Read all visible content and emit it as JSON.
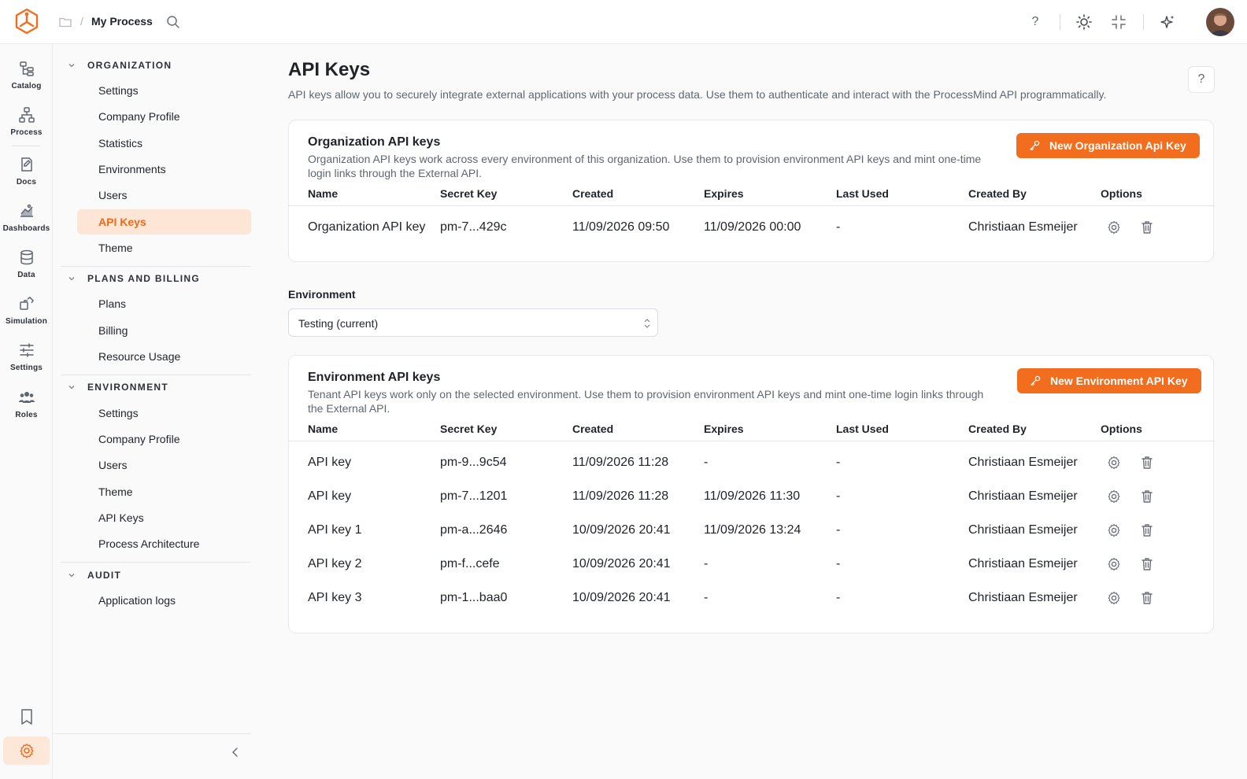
{
  "topbar": {
    "breadcrumb_sep": "/",
    "process_name": "My Process",
    "help_glyph": "?",
    "icons": [
      "logo-icon",
      "folder-icon",
      "search-icon",
      "help-icon",
      "sun-icon",
      "collapse-icon",
      "sparkle-icon",
      "avatar"
    ]
  },
  "rail": {
    "items": [
      {
        "label": "Catalog",
        "icon": "catalog-icon"
      },
      {
        "label": "Process",
        "icon": "process-icon"
      },
      {
        "label": "Docs",
        "icon": "docs-icon"
      },
      {
        "label": "Dashboards",
        "icon": "dashboards-icon"
      },
      {
        "label": "Data",
        "icon": "database-icon"
      },
      {
        "label": "Simulation",
        "icon": "simulation-icon"
      },
      {
        "label": "Settings",
        "icon": "sliders-icon"
      },
      {
        "label": "Roles",
        "icon": "users-icon"
      }
    ]
  },
  "sidenav": {
    "sections": [
      {
        "title": "ORGANIZATION",
        "items": [
          "Settings",
          "Company Profile",
          "Statistics",
          "Environments",
          "Users",
          "API Keys",
          "Theme"
        ]
      },
      {
        "title": "PLANS AND BILLING",
        "items": [
          "Plans",
          "Billing",
          "Resource Usage"
        ]
      },
      {
        "title": "ENVIRONMENT",
        "items": [
          "Settings",
          "Company Profile",
          "Users",
          "Theme",
          "API Keys",
          "Process Architecture"
        ]
      },
      {
        "title": "AUDIT",
        "items": [
          "Application logs"
        ]
      }
    ],
    "active_item": "API Keys"
  },
  "page": {
    "title": "API Keys",
    "description": "API keys allow you to securely integrate external applications with your process data. Use them to authenticate and interact with the ProcessMind API programmatically.",
    "help_label": "?"
  },
  "org_card": {
    "title": "Organization API keys",
    "description": "Organization API keys work across every environment of this organization. Use them to provision environment API keys and mint one-time login links through the External API.",
    "button_label": "New Organization Api Key",
    "columns": [
      "Name",
      "Secret Key",
      "Created",
      "Expires",
      "Last Used",
      "Created By",
      "Options"
    ],
    "rows": [
      {
        "name": "Organization API key",
        "secret": "pm-7...429c",
        "created": "11/09/2026 09:50",
        "expires": "11/09/2026 00:00",
        "last_used": "-",
        "created_by": "Christiaan Esmeijer"
      }
    ]
  },
  "environment": {
    "label": "Environment",
    "selected": "Testing (current)"
  },
  "env_card": {
    "title": "Environment API keys",
    "description": "Tenant API keys work only on the selected environment. Use them to provision environment API keys and mint one-time login links through the External API.",
    "button_label": "New Environment API Key",
    "columns": [
      "Name",
      "Secret Key",
      "Created",
      "Expires",
      "Last Used",
      "Created By",
      "Options"
    ],
    "rows": [
      {
        "name": "API key",
        "secret": "pm-9...9c54",
        "created": "11/09/2026 11:28",
        "expires": "-",
        "last_used": "-",
        "created_by": "Christiaan Esmeijer"
      },
      {
        "name": "API key",
        "secret": "pm-7...1201",
        "created": "11/09/2026 11:28",
        "expires": "11/09/2026 11:30",
        "last_used": "-",
        "created_by": "Christiaan Esmeijer"
      },
      {
        "name": "API key 1",
        "secret": "pm-a...2646",
        "created": "10/09/2026 20:41",
        "expires": "11/09/2026 13:24",
        "last_used": "-",
        "created_by": "Christiaan Esmeijer"
      },
      {
        "name": "API key 2",
        "secret": "pm-f...cefe",
        "created": "10/09/2026 20:41",
        "expires": "-",
        "last_used": "-",
        "created_by": "Christiaan Esmeijer"
      },
      {
        "name": "API key 3",
        "secret": "pm-1...baa0",
        "created": "10/09/2026 20:41",
        "expires": "-",
        "last_used": "-",
        "created_by": "Christiaan Esmeijer"
      }
    ]
  },
  "colors": {
    "accent": "#f26d1e",
    "accent_soft": "#fde6d6",
    "background": "#fafafa"
  }
}
